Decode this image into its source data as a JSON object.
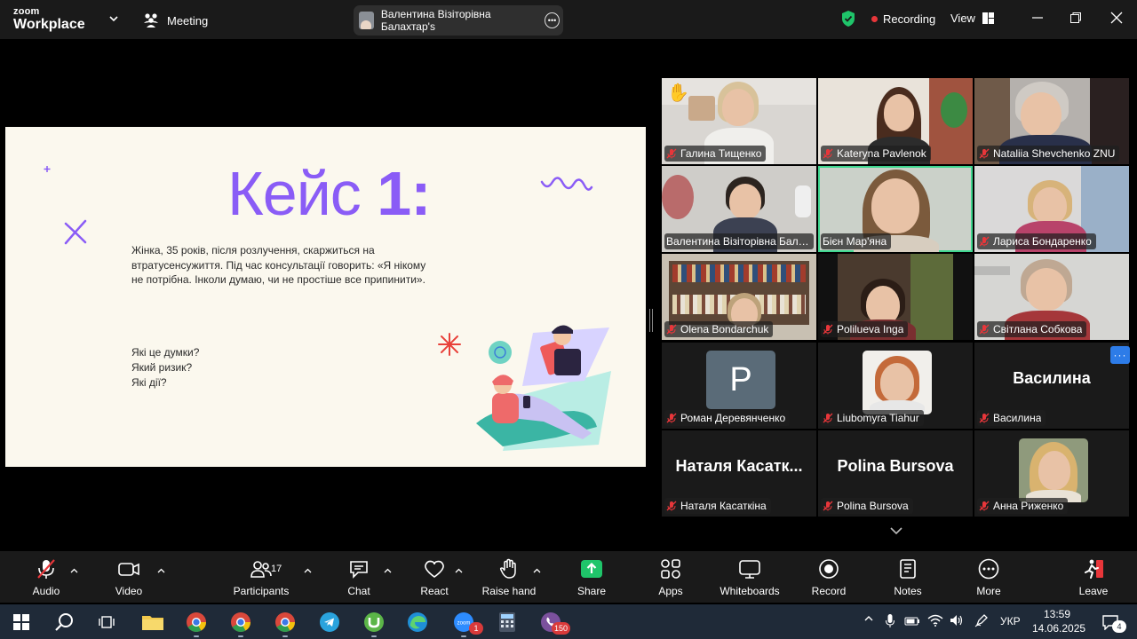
{
  "app": {
    "logo_line1": "zoom",
    "logo_line2": "Workplace"
  },
  "header": {
    "meeting_label": "Meeting",
    "speaker_name": "Валентина Візіторівна Балахтар's",
    "recording_label": "Recording",
    "view_label": "View"
  },
  "slide": {
    "title_word": "Кейс ",
    "title_num": "1:",
    "body": "Жінка, 35 років, після розлучення, скаржиться на втратусенсужиття. Під час консультації говорить: «Я нікому не потрібна. Інколи думаю, чи не простіше все припинити».",
    "questions": [
      "Які це думки?",
      "Який ризик?",
      "Які дії?"
    ]
  },
  "gallery": {
    "tiles": [
      {
        "name": "Галина Тищенко"
      },
      {
        "name": "Kateryna Pavlenok"
      },
      {
        "name": "Nataliia Shevchenko ZNU"
      },
      {
        "name": "Валентина Візіторівна Балахтар"
      },
      {
        "name": "Бієн Мар'яна"
      },
      {
        "name": "Лариса Бондаренко"
      },
      {
        "name": "Olena Bondarchuk"
      },
      {
        "name": "Polilueva Inga"
      },
      {
        "name": "Світлана Собкова"
      },
      {
        "name": "Роман Деревянченко",
        "initial": "P"
      },
      {
        "name": "Liubomyra Tiahur"
      },
      {
        "name": "Василина",
        "card": "Василина"
      },
      {
        "name": "Наталя  Касаткіна",
        "card": "Наталя    Касатк..."
      },
      {
        "name": "Polina Bursova",
        "card": "Polina Bursova"
      },
      {
        "name": "Анна Риженко"
      }
    ],
    "raise_hand_emoji": "✋",
    "more_label": "···"
  },
  "toolbar": {
    "audio": "Audio",
    "video": "Video",
    "participants": "Participants",
    "participants_count": "17",
    "chat": "Chat",
    "react": "React",
    "raise_hand": "Raise hand",
    "share": "Share",
    "apps": "Apps",
    "whiteboards": "Whiteboards",
    "record": "Record",
    "notes": "Notes",
    "more": "More",
    "leave": "Leave"
  },
  "taskbar": {
    "zoom_badge": "1",
    "viber_badge": "150",
    "language": "УКР",
    "time": "13:59",
    "date": "14.06.2025",
    "notifications": "4"
  },
  "colors": {
    "accent_purple": "#8a5cf6",
    "active_speaker": "#3fd68f",
    "share_green": "#1fc56a",
    "leave_red": "#e8363a",
    "mic_off_red": "#e8363a"
  }
}
